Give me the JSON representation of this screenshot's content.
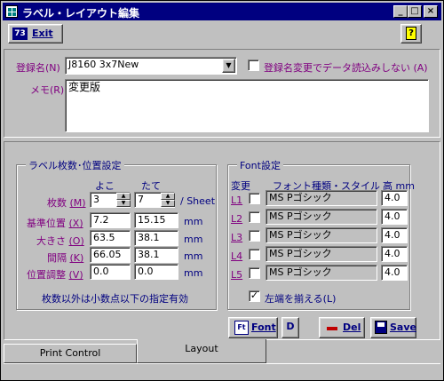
{
  "window": {
    "title": "ラベル・レイアウト編集",
    "min": "_",
    "max": "□",
    "close": "×"
  },
  "toolbar": {
    "exit_icon": "73",
    "exit_label": "Exit",
    "help_icon": "?"
  },
  "registration": {
    "label": "登録名(N)",
    "value": "J8160 3x7New",
    "no_reload_label": "登録名変更でデータ読込みしない (A)"
  },
  "memo": {
    "label": "メモ(R)",
    "value": "変更版"
  },
  "sheet_group": {
    "title": "ラベル枚数･位置設定",
    "col_yoko": "よこ",
    "col_tate": "たて",
    "count": {
      "label": "枚数",
      "key": "(M)",
      "x": "3",
      "y": "7",
      "unit": "/ Sheet"
    },
    "base": {
      "label": "基準位置",
      "key": "(X)",
      "x": "7.2",
      "y": "15.15",
      "unit": "mm"
    },
    "size": {
      "label": "大きさ",
      "key": "(O)",
      "x": "63.5",
      "y": "38.1",
      "unit": "mm"
    },
    "gap": {
      "label": "間隔",
      "key": "(K)",
      "x": "66.05",
      "y": "38.1",
      "unit": "mm"
    },
    "adjust": {
      "label": "位置調整",
      "key": "(V)",
      "x": "0.0",
      "y": "0.0",
      "unit": "mm"
    },
    "note": "枚数以外は小数点以下の指定有効"
  },
  "font_group": {
    "title": "Font設定",
    "col_change": "変更",
    "col_font": "フォント種類・スタイル",
    "col_height": "高 mm",
    "rows": [
      {
        "label": "L1",
        "font": "MS Pゴシック",
        "height": "4.0"
      },
      {
        "label": "L2",
        "font": "MS Pゴシック",
        "height": "4.0"
      },
      {
        "label": "L3",
        "font": "MS Pゴシック",
        "height": "4.0"
      },
      {
        "label": "L4",
        "font": "MS Pゴシック",
        "height": "4.0"
      },
      {
        "label": "L5",
        "font": "MS Pゴシック",
        "height": "4.0"
      }
    ],
    "align_left_label": "左端を揃える(L)",
    "align_left_checked": true
  },
  "actions": {
    "font_label": "Font",
    "font_icon": "Ft",
    "d_label": "D",
    "del_label": "Del",
    "save_label": "Save"
  },
  "tabs": [
    {
      "label": "Print Control"
    },
    {
      "label": "Layout"
    }
  ]
}
